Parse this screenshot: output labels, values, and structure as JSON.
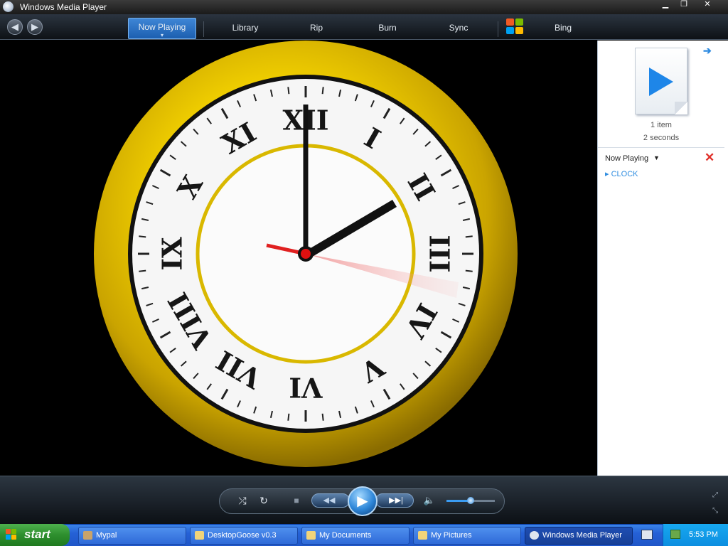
{
  "window": {
    "title": "Windows Media Player",
    "controls": {
      "minimize": "▁",
      "maximize": "❐",
      "close": "✕"
    }
  },
  "toolbar": {
    "back_icon": "back-arrow-icon",
    "forward_icon": "forward-arrow-icon",
    "tabs": [
      {
        "label": "Now Playing",
        "active": true
      },
      {
        "label": "Library",
        "active": false
      },
      {
        "label": "Rip",
        "active": false
      },
      {
        "label": "Burn",
        "active": false
      },
      {
        "label": "Sync",
        "active": false
      },
      {
        "label": "Bing",
        "active": false
      }
    ]
  },
  "video": {
    "clock_numerals": [
      "XII",
      "I",
      "II",
      "III",
      "IV",
      "V",
      "VI",
      "VII",
      "VIII",
      "IX",
      "X",
      "XI"
    ],
    "time_shown": "2:00"
  },
  "sidebar": {
    "item_count": "1 item",
    "duration": "2 seconds",
    "list_title": "Now Playing",
    "playlist": [
      "CLOCK"
    ]
  },
  "controls": {
    "shuffle": "⤮",
    "repeat": "↻",
    "stop": "■",
    "previous": "◀◀",
    "play": "▶",
    "next": "▶▶|",
    "mute": "🔈",
    "volume_level": 0.45
  },
  "taskbar": {
    "start_label": "start",
    "items": [
      {
        "label": "Mypal",
        "active": false
      },
      {
        "label": "DesktopGoose v0.3",
        "active": false
      },
      {
        "label": "My Documents",
        "active": false
      },
      {
        "label": "My Pictures",
        "active": false
      },
      {
        "label": "Windows Media Player",
        "active": true
      }
    ],
    "clock": "5:53 PM"
  },
  "colors": {
    "accent": "#2f8de0",
    "gold": "#f0d000",
    "taskbar_blue": "#2561d6",
    "start_green": "#2e8f2e"
  }
}
